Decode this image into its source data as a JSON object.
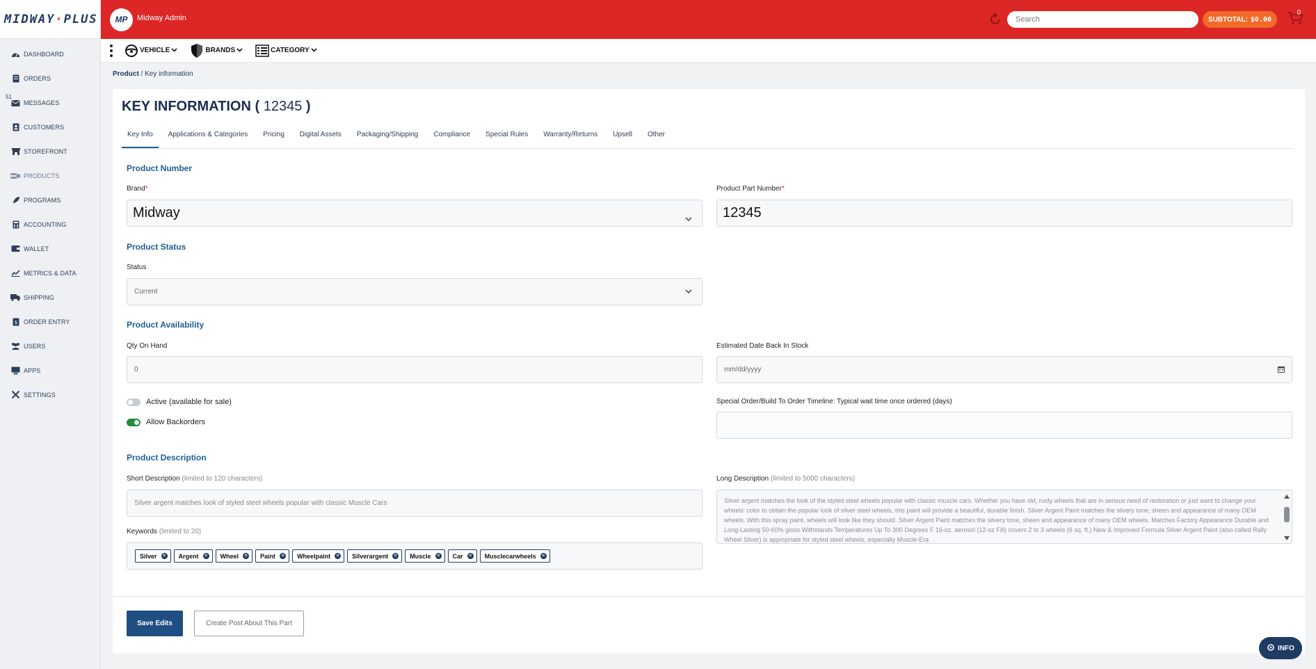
{
  "app": {
    "logo_text": "MIDWAYPLUS",
    "avatar_initials": "MP",
    "admin_name": "Midway Admin"
  },
  "header": {
    "search_placeholder": "Search",
    "subtotal_label": "SUBTOTAL:",
    "subtotal_amount": "$0.00",
    "cart_count": "0"
  },
  "sidebar": {
    "items": [
      {
        "label": "DASHBOARD",
        "icon": "dashboard-icon"
      },
      {
        "label": "ORDERS",
        "icon": "orders-icon"
      },
      {
        "label": "MESSAGES",
        "icon": "messages-icon",
        "badge": "51"
      },
      {
        "label": "CUSTOMERS",
        "icon": "customers-icon"
      },
      {
        "label": "STOREFRONT",
        "icon": "storefront-icon"
      },
      {
        "label": "PRODUCTS",
        "icon": "products-icon"
      },
      {
        "label": "PROGRAMS",
        "icon": "rocket-icon"
      },
      {
        "label": "ACCOUNTING",
        "icon": "calculator-icon"
      },
      {
        "label": "WALLET",
        "icon": "wallet-icon"
      },
      {
        "label": "METRICS & DATA",
        "icon": "chart-icon"
      },
      {
        "label": "SHIPPING",
        "icon": "truck-icon"
      },
      {
        "label": "ORDER ENTRY",
        "icon": "order-entry-icon"
      },
      {
        "label": "USERS",
        "icon": "users-icon"
      },
      {
        "label": "APPS",
        "icon": "monitor-icon"
      },
      {
        "label": "SETTINGS",
        "icon": "tools-icon"
      }
    ]
  },
  "subnav": {
    "vehicle": "VEHICLE",
    "brands": "BRANDS",
    "category": "CATEGORY"
  },
  "breadcrumb": {
    "root": "Product",
    "separator": " / ",
    "current": "Key information"
  },
  "page": {
    "title_prefix": "KEY INFORMATION (",
    "title_number": "12345",
    "title_suffix": ")"
  },
  "tabs": [
    {
      "label": "Key Info",
      "active": true
    },
    {
      "label": "Applications & Categories"
    },
    {
      "label": "Pricing"
    },
    {
      "label": "Digital Assets"
    },
    {
      "label": "Packaging/Shipping"
    },
    {
      "label": "Compliance"
    },
    {
      "label": "Special Rules"
    },
    {
      "label": "Warranty/Returns"
    },
    {
      "label": "Upsell"
    },
    {
      "label": "Other"
    }
  ],
  "form": {
    "product_number_title": "Product Number",
    "brand_label": "Brand",
    "brand_value": "Midway",
    "part_number_label": "Product Part Number",
    "part_number_value": "12345",
    "status_title": "Product Status",
    "status_label": "Status",
    "status_value": "Current",
    "availability_title": "Product Availability",
    "qty_label": "Qty On Hand",
    "qty_value": "0",
    "date_label": "Estimated Date Back In Stock",
    "date_placeholder": "mm/dd/yyyy",
    "active_label": "Active (available for sale)",
    "active_on": false,
    "backorders_label": "Allow Backorders",
    "backorders_on": true,
    "special_order_label": "Special Order/Build To Order Timeline: Typical wait time once ordered (days)",
    "special_order_value": "",
    "description_title": "Product Description",
    "short_desc_label": "Short Description",
    "short_desc_hint": "(limited to 120 characters)",
    "short_desc_value": "Silver argent matches look of styled steel wheels popular with classic Muscle Cars",
    "long_desc_label": "Long Description",
    "long_desc_hint": "(limited to 5000 characters)",
    "long_desc_value": "Silver argent matches the look of the styled steel wheels popular with classic muscle cars. Whether you have old, rusty wheels that are in serious need of restoration or just want to change your wheels' color to obtain the popular look of silver steel wheels, this paint will provide a beautiful, durable finish. Silver Argent Paint matches the silvery tone, sheen and appearance of many OEM wheels. With this spray paint, wheels will look like they should.     Silver Argent Paint matches the silvery tone, sheen and appearance of many OEM wheels.  Matches Factory Appearance Durable and Long-Lasting 50-60% gloss Withstands Temperatures Up To 300 Degrees F 16-oz. aerosol (12-oz Fill) covers 2 to 3 wheels (6 sq. ft.) New & Improved Formula  Silver Argent Paint (also called Rally Wheel Silver) is appropriate for styled steel wheels, especially Muscle-Era",
    "keywords_label": "Keywords",
    "keywords_hint": "(limited to 20)",
    "keywords": [
      "Silver",
      "Argent",
      "Wheel",
      "Paint",
      "Wheelpaint",
      "Silverargent",
      "Muscle",
      "Car",
      "Musclecarwheels"
    ]
  },
  "actions": {
    "save": "Save Edits",
    "create_post": "Create Post About This Part"
  },
  "info_button": "INFO",
  "colors": {
    "header_red": "#dd2626",
    "primary_blue": "#1f4e82",
    "section_blue": "#1f5e94",
    "subtotal_orange": "#f26a2a",
    "toggle_green": "#1f8a3a"
  }
}
